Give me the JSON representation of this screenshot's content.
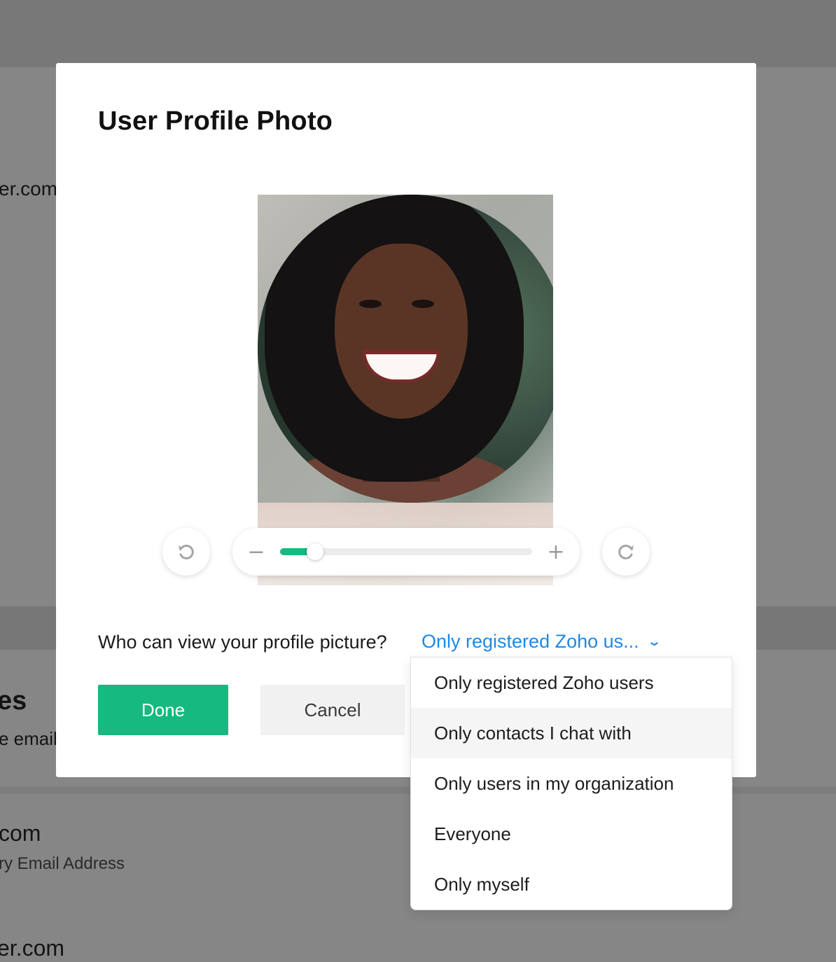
{
  "background": {
    "texts": [
      "er.com",
      "es",
      "e email",
      "com",
      "ry Email Address",
      "er.com"
    ]
  },
  "modal": {
    "title": "User Profile Photo",
    "photo": {
      "zoom_level_fraction": 0.14
    },
    "controls": {
      "zoom_out_symbol": "−",
      "zoom_in_symbol": "+",
      "rotate_left_icon": "rotate-left-icon",
      "rotate_right_icon": "rotate-right-icon"
    },
    "visibility": {
      "label": "Who can view your profile picture?",
      "selected": "Only registered Zoho us...",
      "options": [
        "Only registered Zoho users",
        "Only contacts I chat with",
        "Only users in my organization",
        "Everyone",
        "Only myself"
      ],
      "hovered_option": "Only contacts I chat with"
    },
    "buttons": {
      "done": "Done",
      "cancel": "Cancel"
    }
  },
  "colors": {
    "accent_green": "#16b97f",
    "link_blue": "#1e88e5",
    "overlay_gray": "#7a7a7b"
  }
}
